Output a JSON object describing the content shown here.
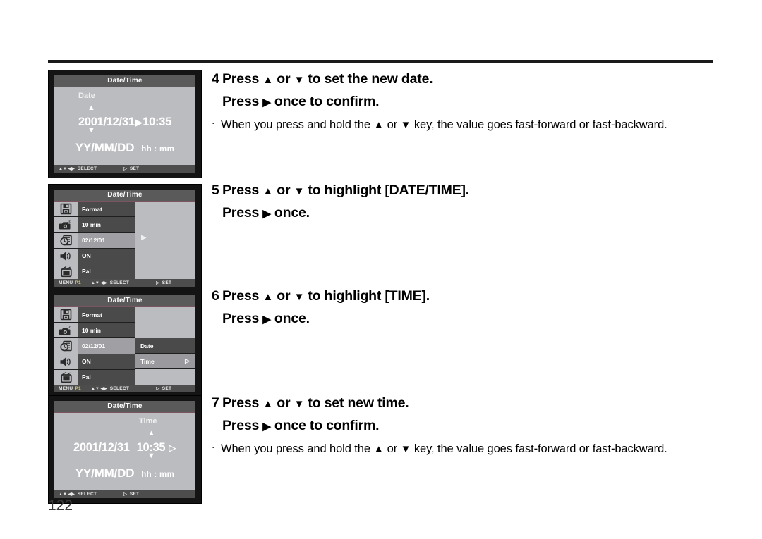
{
  "page": {
    "number": "122"
  },
  "screens": [
    {
      "id": "date-entry",
      "title": "Date/Time",
      "sublabel": "Date",
      "sublabel_side": "left",
      "date": "2001/12/31",
      "separator": "▶",
      "time": "10:35",
      "trailing_arrow": "",
      "units_date": "YY/MM/DD",
      "units_time": "hh : mm",
      "caret_up": "▲",
      "caret_down": "▼",
      "footer": {
        "menu_label": "",
        "page_label": "",
        "arrows": "▲▼  ◀▶",
        "select_label": "SELECT",
        "set_icon": "▷",
        "set_label": "SET"
      }
    },
    {
      "id": "menu-datetime-highlight",
      "title": "Date/Time",
      "rows": [
        {
          "icon": "format-icon",
          "label": "Format",
          "selected": false
        },
        {
          "icon": "auto-off-camera-icon",
          "label": "10 min",
          "selected": false
        },
        {
          "icon": "clock-icon",
          "label": "02/12/01",
          "selected": true
        },
        {
          "icon": "speaker-icon",
          "label": "ON",
          "selected": false
        },
        {
          "icon": "tv-icon",
          "label": "Pal",
          "selected": false
        }
      ],
      "submenu": [],
      "submenu_marker": "▶",
      "footer": {
        "menu_label": "MENU",
        "page_label": "P1",
        "arrows": "▲▼  ◀▶",
        "select_label": "SELECT",
        "set_icon": "▷",
        "set_label": "SET"
      }
    },
    {
      "id": "menu-time-submenu",
      "title": "Date/Time",
      "rows": [
        {
          "icon": "format-icon",
          "label": "Format",
          "selected": false
        },
        {
          "icon": "auto-off-camera-icon",
          "label": "10 min",
          "selected": false
        },
        {
          "icon": "clock-icon",
          "label": "02/12/01",
          "selected": true
        },
        {
          "icon": "speaker-icon",
          "label": "ON",
          "selected": false
        },
        {
          "icon": "tv-icon",
          "label": "Pal",
          "selected": false
        }
      ],
      "submenu": [
        {
          "label": "",
          "state": "empty",
          "arrow": ""
        },
        {
          "label": "",
          "state": "empty",
          "arrow": ""
        },
        {
          "label": "Date",
          "state": "filled",
          "arrow": ""
        },
        {
          "label": "Time",
          "state": "selected",
          "arrow": "▷"
        },
        {
          "label": "",
          "state": "empty",
          "arrow": ""
        }
      ],
      "submenu_marker": "",
      "footer": {
        "menu_label": "MENU",
        "page_label": "P1",
        "arrows": "▲▼  ◀▶",
        "select_label": "SELECT",
        "set_icon": "▷",
        "set_label": "SET"
      }
    },
    {
      "id": "time-entry",
      "title": "Date/Time",
      "sublabel": "Time",
      "sublabel_side": "right",
      "date": "2001/12/31",
      "separator": "",
      "time": "10:35",
      "trailing_arrow": "▷",
      "units_date": "YY/MM/DD",
      "units_time": "hh : mm",
      "caret_up": "▲",
      "caret_down": "▼",
      "footer": {
        "menu_label": "",
        "page_label": "",
        "arrows": "▲▼  ◀▶",
        "select_label": "SELECT",
        "set_icon": "▷",
        "set_label": "SET"
      }
    }
  ],
  "steps": [
    {
      "number": "4",
      "line1_a": "Press ",
      "line1_up": "▲",
      "line1_b": " or ",
      "line1_down": "▼",
      "line1_c": " to set the new date.",
      "line2_a": "Press ",
      "line2_arrow": "▶",
      "line2_b": " once to confirm.",
      "bullet": {
        "dot": "·",
        "part1": "When you press and hold the ",
        "up": "▲",
        "mid": " or ",
        "down": "▼",
        "part2": " key, the value goes fast-forward or fast-backward."
      }
    },
    {
      "number": "5",
      "line1_a": "Press ",
      "line1_up": "▲",
      "line1_b": " or ",
      "line1_down": "▼",
      "line1_c": " to highlight [DATE/TIME].",
      "line2_a": "Press ",
      "line2_arrow": "▶",
      "line2_b": " once.",
      "bullet": null
    },
    {
      "number": "6",
      "line1_a": "Press ",
      "line1_up": "▲",
      "line1_b": " or ",
      "line1_down": "▼",
      "line1_c": " to highlight [TIME].",
      "line2_a": "Press ",
      "line2_arrow": "▶",
      "line2_b": " once.",
      "bullet": null
    },
    {
      "number": "7",
      "line1_a": "Press ",
      "line1_up": "▲",
      "line1_b": " or ",
      "line1_down": "▼",
      "line1_c": " to set new time.",
      "line2_a": "Press ",
      "line2_arrow": "▶",
      "line2_b": " once to confirm.",
      "bullet": {
        "dot": "·",
        "part1": "When you press and hold the ",
        "up": "▲",
        "mid": " or ",
        "down": "▼",
        "part2": " key, the value goes fast-forward or fast-backward."
      }
    }
  ],
  "colors": {
    "lcd_background": "#bbbcc0",
    "lcd_frame": "#141414",
    "title_bar": "#5a5a5a",
    "menu_row": "#4a4a4a",
    "menu_row_selected": "#a0a0a4",
    "footer_bar": "#4d4d4d",
    "page_accent": "#d8cf7a",
    "rule": "#1a1a1a"
  }
}
